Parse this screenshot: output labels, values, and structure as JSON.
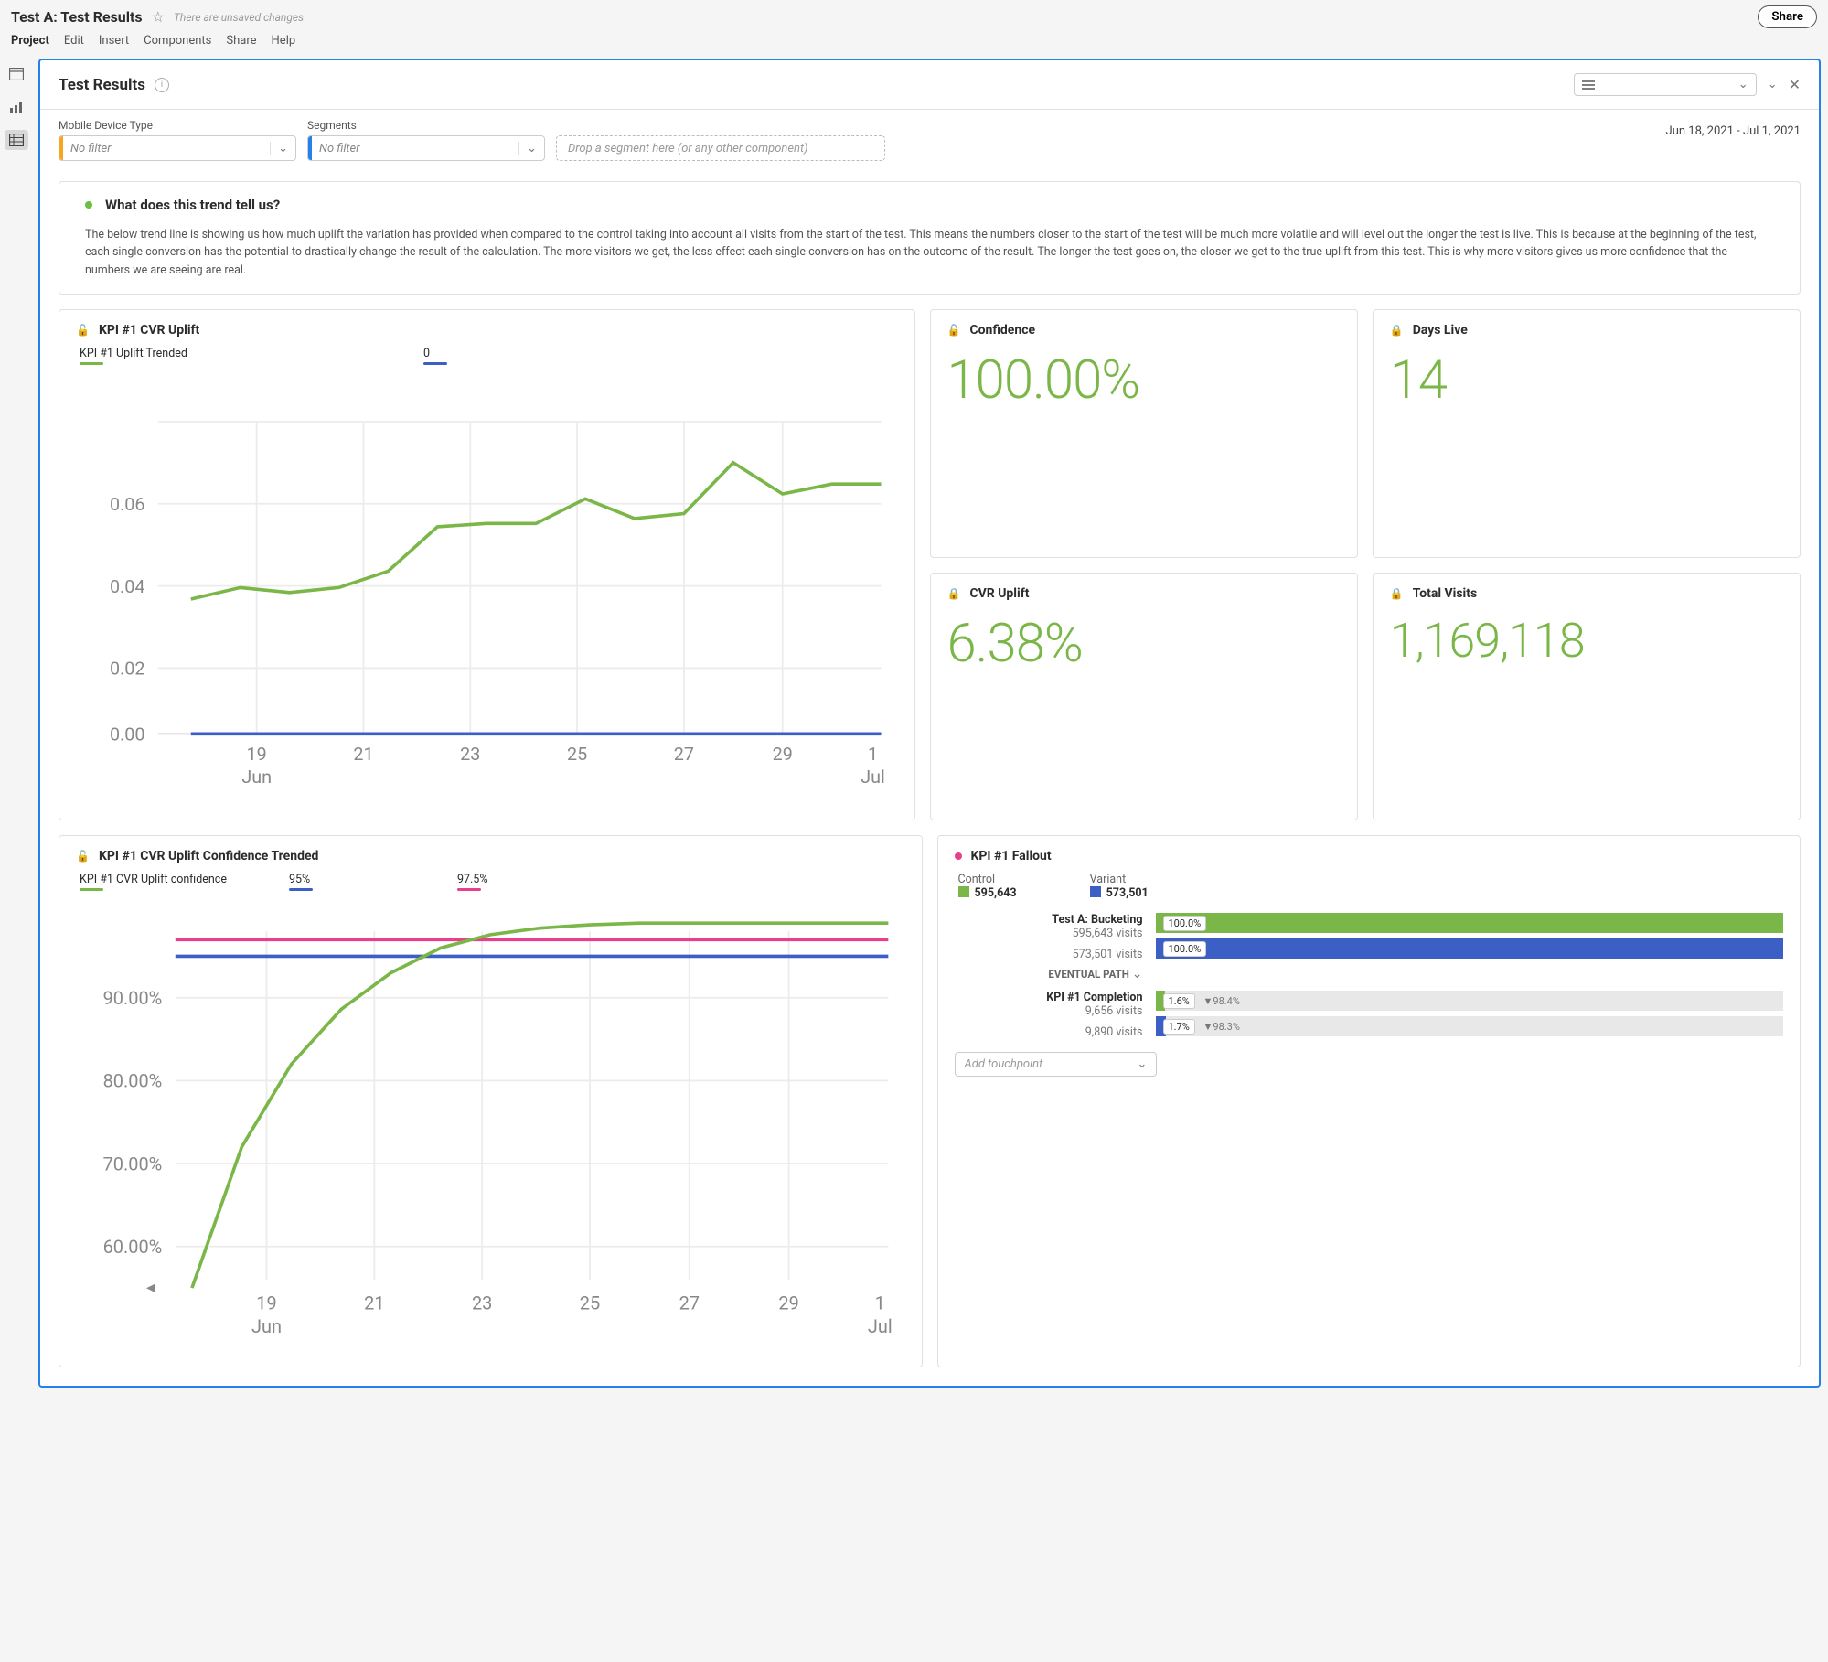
{
  "header": {
    "title": "Test A: Test Results",
    "unsaved": "There are unsaved changes",
    "share": "Share"
  },
  "menu": [
    "Project",
    "Edit",
    "Insert",
    "Components",
    "Share",
    "Help"
  ],
  "panel": {
    "title": "Test Results"
  },
  "filters": {
    "mobile_label": "Mobile Device Type",
    "mobile_value": "No filter",
    "segments_label": "Segments",
    "segments_value": "No filter",
    "drop_hint": "Drop a segment here (or any other component)",
    "date_range": "Jun 18, 2021 - Jul 1, 2021"
  },
  "callout": {
    "title": "What does this trend tell us?",
    "body": "The below trend line is showing us how much uplift the variation has provided when compared to the control taking into account all visits from the start of the test. This means the numbers closer to the start of the test will be much more volatile and will level out the longer the test is live. This is because at the beginning of the test, each single conversion has the potential to drastically change the result of the calculation. The more visitors we get, the less effect each single conversion has on the outcome of the result. The longer the test goes on, the closer we get to the true uplift from this test. This is why more visitors gives us more confidence that the numbers we are seeing are real."
  },
  "cards": {
    "uplift_trend": {
      "title": "KPI #1 CVR Uplift",
      "legend": [
        {
          "label": "KPI #1 Uplift Trended",
          "swatch": "sw-green"
        },
        {
          "label": "0",
          "swatch": "sw-navy"
        }
      ]
    },
    "confidence": {
      "title": "Confidence",
      "value": "100.00%"
    },
    "days_live": {
      "title": "Days Live",
      "value": "14"
    },
    "cvr_uplift": {
      "title": "CVR Uplift",
      "value": "6.38%"
    },
    "total_visits": {
      "title": "Total Visits",
      "value": "1,169,118"
    },
    "conf_trend": {
      "title": "KPI #1 CVR Uplift Confidence Trended",
      "legend": [
        {
          "label": "KPI #1 CVR Uplift confidence",
          "swatch": "sw-green"
        },
        {
          "label": "95%",
          "swatch": "sw-navy"
        },
        {
          "label": "97.5%",
          "swatch": "sw-pink"
        }
      ]
    },
    "fallout": {
      "title": "KPI #1 Fallout",
      "control_label": "Control",
      "control_value": "595,643",
      "variant_label": "Variant",
      "variant_value": "573,501",
      "step1": {
        "title": "Test A: Bucketing",
        "control_visits": "595,643 visits",
        "variant_visits": "573,501 visits",
        "control_pct": "100.0%",
        "variant_pct": "100.0%"
      },
      "eventual": "EVENTUAL PATH",
      "step2": {
        "title": "KPI #1 Completion",
        "control_visits": "9,656 visits",
        "variant_visits": "9,890 visits",
        "control_pct": "1.6%",
        "control_drop": "▼98.4%",
        "variant_pct": "1.7%",
        "variant_drop": "▼98.3%"
      },
      "add_touchpoint": "Add touchpoint"
    }
  },
  "chart_data": [
    {
      "type": "line",
      "title": "KPI #1 CVR Uplift",
      "x_categories": [
        "19",
        "21",
        "23",
        "25",
        "27",
        "29",
        "1"
      ],
      "x_month_labels": [
        "Jun",
        "",
        "",
        "",
        "",
        "",
        "Jul"
      ],
      "y_ticks": [
        0.0,
        0.02,
        0.04,
        0.06
      ],
      "ylim": [
        0,
        0.075
      ],
      "series": [
        {
          "name": "KPI #1 Uplift Trended",
          "color": "#7ab648",
          "x": [
            18,
            19,
            20,
            21,
            22,
            23,
            24,
            25,
            26,
            27,
            28,
            29,
            30,
            1
          ],
          "values": [
            0.041,
            0.044,
            0.043,
            0.044,
            0.048,
            0.057,
            0.058,
            0.058,
            0.063,
            0.059,
            0.06,
            0.07,
            0.064,
            0.066
          ]
        },
        {
          "name": "0",
          "color": "#3b5fc4",
          "x": [
            18,
            19,
            20,
            21,
            22,
            23,
            24,
            25,
            26,
            27,
            28,
            29,
            30,
            1
          ],
          "values": [
            0,
            0,
            0,
            0,
            0,
            0,
            0,
            0,
            0,
            0,
            0,
            0,
            0,
            0
          ]
        }
      ]
    },
    {
      "type": "line",
      "title": "KPI #1 CVR Uplift Confidence Trended",
      "x_categories": [
        "19",
        "21",
        "23",
        "25",
        "27",
        "29",
        "1"
      ],
      "x_month_labels": [
        "Jun",
        "",
        "",
        "",
        "",
        "",
        "Jul"
      ],
      "y_ticks": [
        "60.00%",
        "70.00%",
        "80.00%",
        "90.00%"
      ],
      "ylim": [
        55,
        100
      ],
      "series": [
        {
          "name": "KPI #1 CVR Uplift confidence",
          "color": "#7ab648",
          "x": [
            18,
            19,
            20,
            21,
            22,
            23,
            24,
            25,
            26,
            27,
            28,
            29,
            30,
            1
          ],
          "values": [
            55,
            72,
            82,
            90,
            95,
            97,
            99,
            99.5,
            99.8,
            99.9,
            100,
            100,
            100,
            100
          ]
        },
        {
          "name": "95%",
          "color": "#3b5fc4",
          "constant": 95
        },
        {
          "name": "97.5%",
          "color": "#e83e8c",
          "constant": 97.5
        }
      ]
    }
  ]
}
